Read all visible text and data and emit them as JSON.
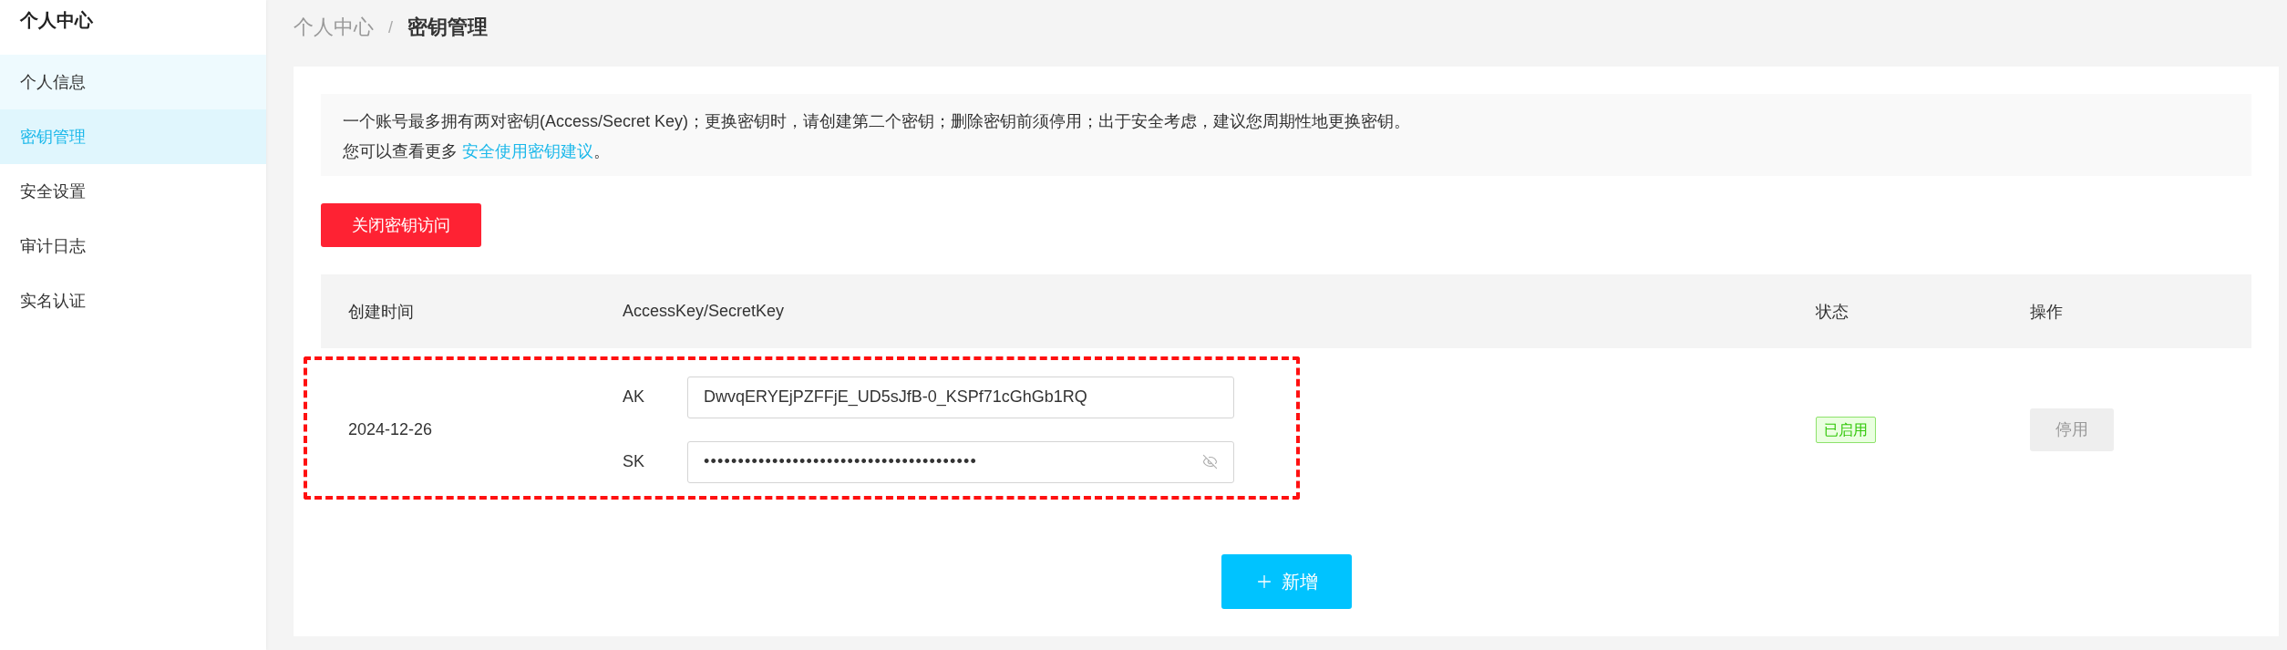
{
  "sidebar": {
    "title": "个人中心",
    "items": [
      {
        "label": "个人信息",
        "selected": false,
        "hovered": true
      },
      {
        "label": "密钥管理",
        "selected": true,
        "hovered": false
      },
      {
        "label": "安全设置",
        "selected": false,
        "hovered": false
      },
      {
        "label": "审计日志",
        "selected": false,
        "hovered": false
      },
      {
        "label": "实名认证",
        "selected": false,
        "hovered": false
      }
    ]
  },
  "breadcrumb": {
    "separator": "/",
    "items": [
      {
        "label": "个人中心",
        "current": false
      },
      {
        "label": "密钥管理",
        "current": true
      }
    ]
  },
  "notice": {
    "text": "一个账号最多拥有两对密钥(Access/Secret Key)；更换密钥时，请创建第二个密钥；删除密钥前须停用；出于安全考虑，建议您周期性地更换密钥。",
    "more_prefix": "您可以查看更多 ",
    "link": "安全使用密钥建议",
    "more_suffix": "。"
  },
  "close_access_button": "关闭密钥访问",
  "table": {
    "columns": [
      "创建时间",
      "AccessKey/SecretKey",
      "状态",
      "操作"
    ],
    "rows": [
      {
        "created": "2024-12-26",
        "annotated": true,
        "keys": [
          {
            "label": "AK",
            "value": "DwvqERYEjPZFFjE_UD5sJfB-0_KSPf71cGhGb1RQ",
            "masked": false
          },
          {
            "label": "SK",
            "value": "••••••••••••••••••••••••••••••••••••••••",
            "masked": true
          }
        ],
        "status": {
          "label": "已启用",
          "kind": "enabled"
        },
        "action": {
          "label": "停用",
          "disabled": true
        }
      }
    ]
  },
  "add_button": "新增"
}
